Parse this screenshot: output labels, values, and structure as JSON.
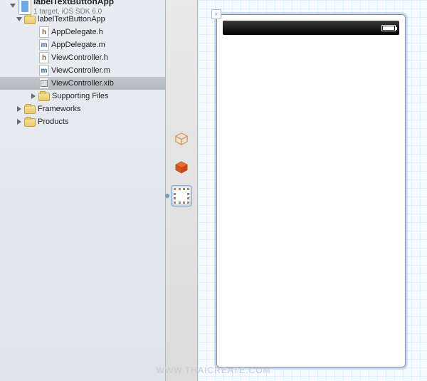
{
  "project": {
    "name": "labelTextButtonApp",
    "subtitle": "1 target, iOS SDK 6.0"
  },
  "tree": {
    "root": {
      "label": "labelTextButtonApp",
      "open": true,
      "children": [
        {
          "label": "AppDelegate.h",
          "kind": "h"
        },
        {
          "label": "AppDelegate.m",
          "kind": "m"
        },
        {
          "label": "ViewController.h",
          "kind": "h"
        },
        {
          "label": "ViewController.m",
          "kind": "m"
        },
        {
          "label": "ViewController.xib",
          "kind": "xib",
          "selected": true
        },
        {
          "label": "Supporting Files",
          "kind": "folder",
          "open": false
        }
      ]
    },
    "frameworks": {
      "label": "Frameworks",
      "open": false
    },
    "products": {
      "label": "Products",
      "open": false
    }
  },
  "dock": {
    "items": [
      {
        "name": "files-owner",
        "selected": false
      },
      {
        "name": "first-responder",
        "selected": false
      },
      {
        "name": "view",
        "selected": true
      }
    ]
  },
  "canvas": {
    "device_kind": "iPhone",
    "status_bar_visible": true,
    "battery_level": 1.0
  },
  "watermark": "WWW.THAICREATE.COM"
}
